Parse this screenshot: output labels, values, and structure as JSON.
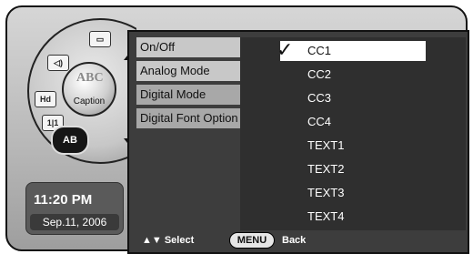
{
  "caption_dial": {
    "center_label": "Caption",
    "center_logo_text": "ABC",
    "ab_label": "AB",
    "icons": [
      "tv-icon",
      "speaker-icon",
      "antenna-icon",
      "clock-icon"
    ],
    "icon_glyph_tv": "▭",
    "icon_glyph_speaker": "◁)",
    "icon_glyph_antenna": "ᴴᴵ",
    "icon_glyph_clock": "1|1"
  },
  "status": {
    "time": "11:20 PM",
    "date": "Sep.11, 2006"
  },
  "menu": {
    "items": [
      {
        "label": "On/Off"
      },
      {
        "label": "Analog Mode"
      },
      {
        "label": "Digital Mode"
      },
      {
        "label": "Digital Font Option"
      }
    ]
  },
  "submenu": {
    "items": [
      {
        "label": "CC1"
      },
      {
        "label": "CC2"
      },
      {
        "label": "CC3"
      },
      {
        "label": "CC4"
      },
      {
        "label": "TEXT1"
      },
      {
        "label": "TEXT2"
      },
      {
        "label": "TEXT3"
      },
      {
        "label": "TEXT4"
      }
    ],
    "selected_index": 0
  },
  "footer": {
    "select_label": "▲▼ Select",
    "menu_label": "MENU",
    "back_label": "Back"
  }
}
